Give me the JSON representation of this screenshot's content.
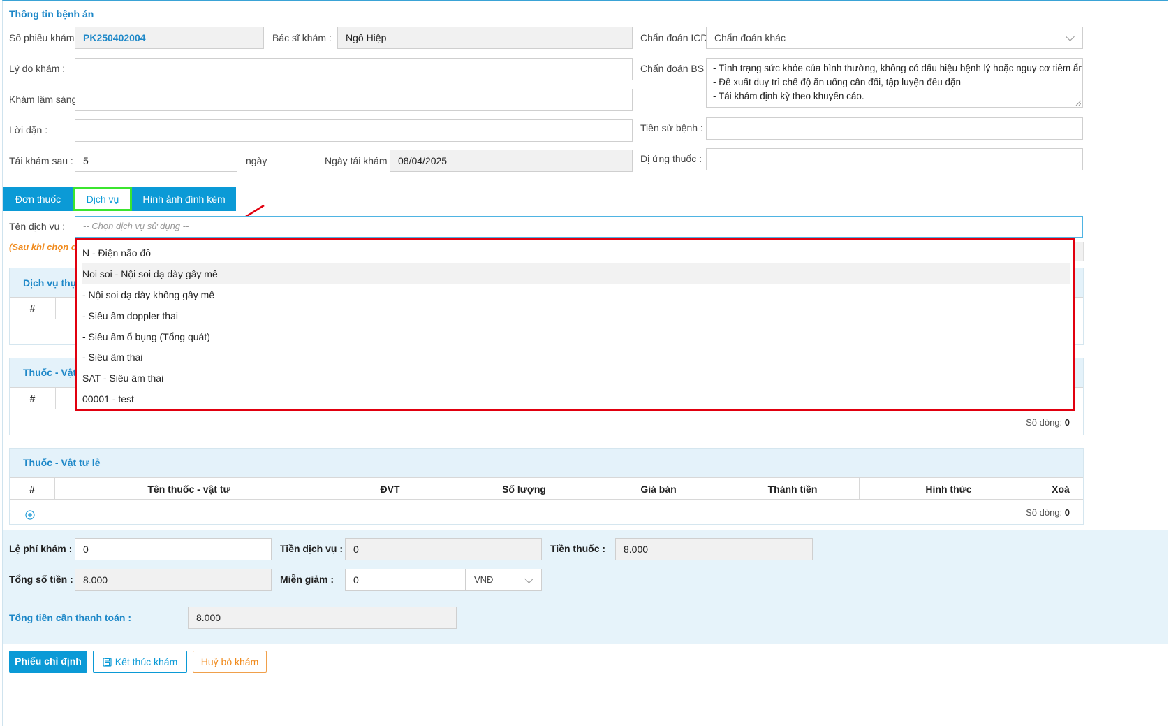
{
  "section_title": "Thông tin bệnh án",
  "form": {
    "so_phieu_label": "Số phiếu khám :",
    "so_phieu_value": "PK250402004",
    "bac_si_label": "Bác sĩ khám :",
    "bac_si_value": "Ngô Hiệp",
    "chan_doan_icd_label": "Chẩn đoán ICD :",
    "chan_doan_icd_value": "Chẩn đoán khác",
    "ly_do_label": "Lý do khám :",
    "ly_do_value": "",
    "chan_doan_bs_label": "Chẩn đoán BS :",
    "chan_doan_bs_lines": [
      "- Tình trạng sức khỏe của bình thường, không có dấu hiệu bệnh lý hoặc nguy cơ tiềm ẩn.",
      "- Đề xuất duy trì chế độ ăn uống cân đối, tập luyện đều đặn",
      "- Tái khám định kỳ theo khuyến cáo."
    ],
    "kham_ls_label": "Khám lâm sàng :",
    "kham_ls_value": "",
    "loi_dan_label": "Lời dặn :",
    "loi_dan_value": "",
    "tien_su_label": "Tiền sử bệnh :",
    "tien_su_value": "",
    "tai_kham_label": "Tái khám sau :",
    "tai_kham_value": "5",
    "ngay_unit": "ngày",
    "ngay_tai_kham_label": "Ngày tái khám :",
    "ngay_tai_kham_value": "08/04/2025",
    "di_ung_label": "Dị ứng thuốc :",
    "di_ung_value": ""
  },
  "tabs": [
    {
      "label": "Đơn thuốc"
    },
    {
      "label": "Dịch vụ"
    },
    {
      "label": "Hình ảnh đính kèm"
    }
  ],
  "service": {
    "label": "Tên dịch vụ :",
    "placeholder": "-- Chọn dịch vụ sử dụng --",
    "note_visible": "(Sau khi chọn dị",
    "options": [
      "N - Điện não đồ",
      "Noi soi - Nội soi dạ dày gây mê",
      "- Nội soi dạ dày không gây mê",
      "- Siêu âm doppler thai",
      "- Siêu âm ổ bụng (Tổng quát)",
      "- Siêu âm thai",
      "SAT - Siêu âm thai",
      "00001 - test"
    ],
    "highlighted_index": 1
  },
  "panels": {
    "dich_vu_title_visible": "Dịch vụ thực",
    "thuoc_vattu_title_visible": "Thuốc - Vật",
    "hash": "#",
    "so_dong_label": "Số dòng:",
    "so_dong_value_2": "0"
  },
  "thuoc_le": {
    "title": "Thuốc - Vật tư lẻ",
    "columns": [
      "#",
      "Tên thuốc - vật tư",
      "ĐVT",
      "Số lượng",
      "Giá bán",
      "Thành tiền",
      "Hình thức",
      "Xoá"
    ],
    "so_dong_label": "Số dòng:",
    "so_dong_value": "0"
  },
  "totals": {
    "le_phi_label": "Lệ phí khám :",
    "le_phi_value": "0",
    "tien_dv_label": "Tiền dịch vụ :",
    "tien_dv_value": "0",
    "tien_thuoc_label": "Tiền thuốc :",
    "tien_thuoc_value": "8.000",
    "tong_so_label": "Tổng số tiền :",
    "tong_so_value": "8.000",
    "mien_giam_label": "Miễn giảm :",
    "mien_giam_value": "0",
    "currency": "VNĐ",
    "can_tt_label": "Tổng tiền cần thanh toán :",
    "can_tt_value": "8.000"
  },
  "buttons": {
    "phieu_chi_dinh": "Phiếu chỉ định",
    "ket_thuc": "Kết thúc khám",
    "huy_bo": "Huỷ bỏ khám"
  },
  "colors": {
    "accent": "#0b9ad6",
    "title_blue": "#1e88c8",
    "highlight_red": "#e1000f",
    "highlight_green": "#3be52f",
    "cancel_orange": "#f0a04b"
  }
}
